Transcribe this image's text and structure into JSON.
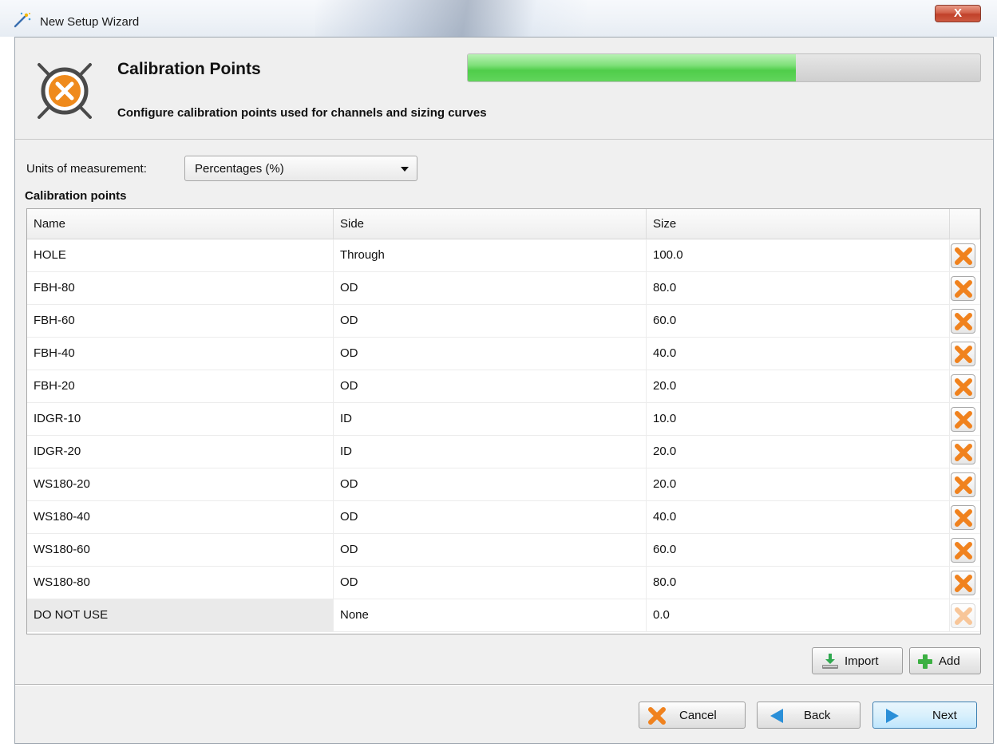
{
  "window": {
    "title": "New Setup Wizard",
    "close_label": "X",
    "icon": "wizard-wand-icon"
  },
  "header": {
    "title": "Calibration Points",
    "subtitle": "Configure calibration points used for channels and sizing curves",
    "icon": "calibration-target-icon",
    "progress_fraction": 0.64,
    "progress_color": "#4fcd4a"
  },
  "units": {
    "label": "Units of measurement:",
    "selected": "Percentages (%)"
  },
  "calibration": {
    "section_label": "Calibration points",
    "columns": [
      "Name",
      "Side",
      "Size"
    ],
    "rows": [
      {
        "name": "HOLE",
        "side": "Through",
        "size": "100.0",
        "enabled": true
      },
      {
        "name": "FBH-80",
        "side": "OD",
        "size": "80.0",
        "enabled": true
      },
      {
        "name": "FBH-60",
        "side": "OD",
        "size": "60.0",
        "enabled": true
      },
      {
        "name": "FBH-40",
        "side": "OD",
        "size": "40.0",
        "enabled": true
      },
      {
        "name": "FBH-20",
        "side": "OD",
        "size": "20.0",
        "enabled": true
      },
      {
        "name": "IDGR-10",
        "side": "ID",
        "size": "10.0",
        "enabled": true
      },
      {
        "name": "IDGR-20",
        "side": "ID",
        "size": "20.0",
        "enabled": true
      },
      {
        "name": "WS180-20",
        "side": "OD",
        "size": "20.0",
        "enabled": true
      },
      {
        "name": "WS180-40",
        "side": "OD",
        "size": "40.0",
        "enabled": true
      },
      {
        "name": "WS180-60",
        "side": "OD",
        "size": "60.0",
        "enabled": true
      },
      {
        "name": "WS180-80",
        "side": "OD",
        "size": "80.0",
        "enabled": true
      },
      {
        "name": "DO NOT USE",
        "side": "None",
        "size": "0.0",
        "enabled": false
      }
    ]
  },
  "table_buttons": {
    "import_label": "Import",
    "add_label": "Add"
  },
  "footer": {
    "cancel_label": "Cancel",
    "back_label": "Back",
    "next_label": "Next"
  },
  "colors": {
    "delete_orange": "#f0821e",
    "accent_blue": "#2a8fd8",
    "add_green": "#3cb043"
  }
}
